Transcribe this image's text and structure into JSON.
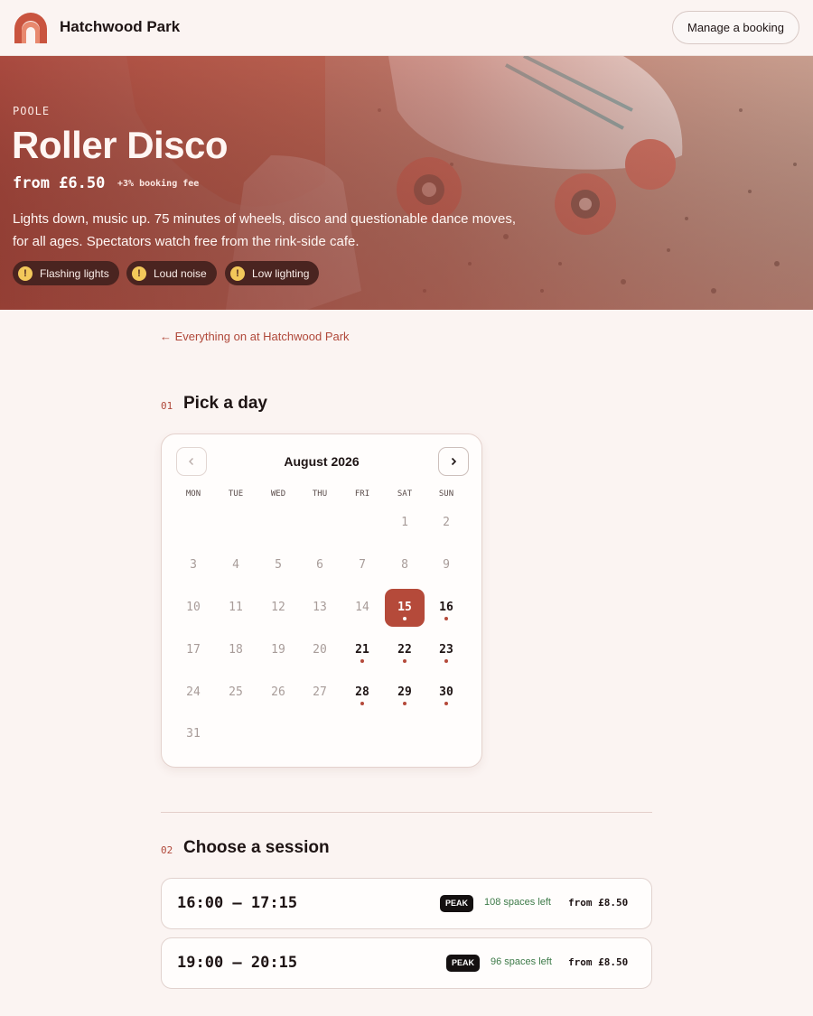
{
  "header": {
    "brand": "Hatchwood Park",
    "manage_label": "Manage a booking"
  },
  "hero": {
    "kicker": "POOLE",
    "title": "Roller Disco",
    "price": "from £6.50",
    "fee": "+3% booking fee",
    "description": "Lights down, music up. 75 minutes of wheels, disco and questionable dance moves, for all ages. Spectators watch free from the rink-side cafe.",
    "warnings": [
      "Flashing lights",
      "Loud noise",
      "Low lighting"
    ],
    "warning_icon": "!"
  },
  "back_link": "← Everything on at Hatchwood Park",
  "step1": {
    "num": "01",
    "title": "Pick a day"
  },
  "calendar": {
    "month": "August 2026",
    "prev_icon": "chevron-left-icon",
    "next_icon": "chevron-right-icon",
    "weekdays": [
      "MON",
      "TUE",
      "WED",
      "THU",
      "FRI",
      "SAT",
      "SUN"
    ],
    "days": [
      "1",
      "2",
      "3",
      "4",
      "5",
      "6",
      "7",
      "8",
      "9",
      "10",
      "11",
      "12",
      "13",
      "14",
      "15",
      "16",
      "17",
      "18",
      "19",
      "20",
      "21",
      "22",
      "23",
      "24",
      "25",
      "26",
      "27",
      "28",
      "29",
      "30",
      "31"
    ],
    "selected": "15",
    "available": [
      "15",
      "16",
      "21",
      "22",
      "23",
      "28",
      "29",
      "30"
    ]
  },
  "step2": {
    "num": "02",
    "title": "Choose a session"
  },
  "sessions": [
    {
      "time": "16:00 – 17:15",
      "badge": "PEAK",
      "spaces": "108 spaces left",
      "price": "from £8.50"
    },
    {
      "time": "19:00 – 20:15",
      "badge": "PEAK",
      "spaces": "96 spaces left",
      "price": "from £8.50"
    }
  ],
  "colors": {
    "accent": "#b54a3a",
    "background": "#fbf4f2",
    "spaces_green": "#3d7a48"
  }
}
